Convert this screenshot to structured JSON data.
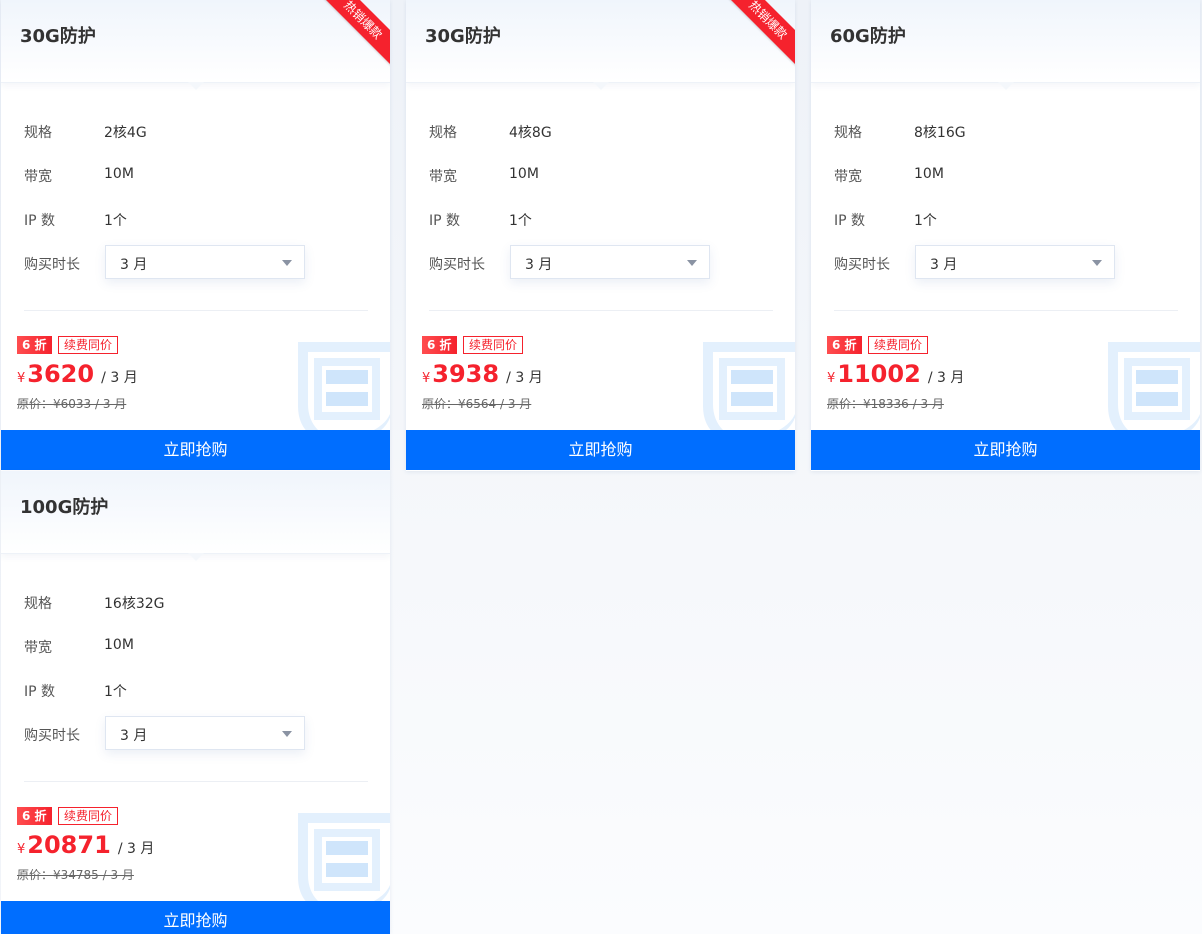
{
  "spec_labels": {
    "spec": "规格",
    "bandwidth": "带宽",
    "ip": "IP 数",
    "duration": "购买时长"
  },
  "currency": "¥",
  "buy_label": "立即抢购",
  "accent_color": "#006eff",
  "price_color": "#f5222d",
  "cards": [
    {
      "title": "30G防护",
      "ribbon": "热销爆款",
      "spec": "2核4G",
      "bandwidth": "10M",
      "ip": "1个",
      "duration": "3 月",
      "discount": "6 折",
      "renew": "续费同价",
      "price": "3620",
      "per": "/ 3 月",
      "original": "原价：¥6033 / 3 月"
    },
    {
      "title": "30G防护",
      "ribbon": "热销爆款",
      "spec": "4核8G",
      "bandwidth": "10M",
      "ip": "1个",
      "duration": "3 月",
      "discount": "6 折",
      "renew": "续费同价",
      "price": "3938",
      "per": "/ 3 月",
      "original": "原价：¥6564 / 3 月"
    },
    {
      "title": "60G防护",
      "ribbon": "",
      "spec": "8核16G",
      "bandwidth": "10M",
      "ip": "1个",
      "duration": "3 月",
      "discount": "6 折",
      "renew": "续费同价",
      "price": "11002",
      "per": "/ 3 月",
      "original": "原价：¥18336 / 3 月"
    },
    {
      "title": "100G防护",
      "ribbon": "",
      "spec": "16核32G",
      "bandwidth": "10M",
      "ip": "1个",
      "duration": "3 月",
      "discount": "6 折",
      "renew": "续费同价",
      "price": "20871",
      "per": "/ 3 月",
      "original": "原价：¥34785 / 3 月"
    }
  ]
}
